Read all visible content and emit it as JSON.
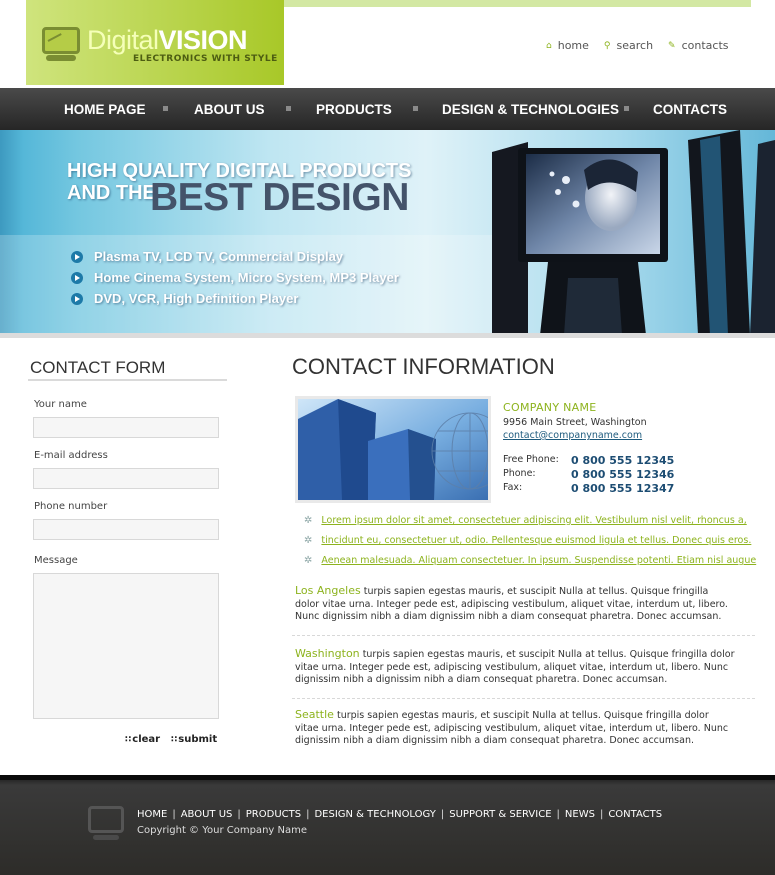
{
  "brand": {
    "name_light": "Digital",
    "name_bold": "VISION",
    "tagline": "ELECTRONICS WITH STYLE",
    "accent_color": "#8db31e"
  },
  "top_links": [
    {
      "icon": "home-icon",
      "label": "home"
    },
    {
      "icon": "search-icon",
      "label": "search"
    },
    {
      "icon": "contacts-icon",
      "label": "contacts"
    }
  ],
  "nav": [
    "HOME PAGE",
    "ABOUT US",
    "PRODUCTS",
    "DESIGN & TECHNOLOGIES",
    "CONTACTS"
  ],
  "banner": {
    "line1": "HIGH QUALITY DIGITAL PRODUCTS",
    "line2a": "AND THE",
    "line2b": "BEST DESIGN",
    "bullets": [
      "Plasma TV, LCD TV, Commercial Display",
      "Home Cinema System, Micro System, MP3 Player",
      "DVD, VCR, High Definition Player"
    ]
  },
  "contact_form": {
    "title": "CONTACT FORM",
    "fields": [
      "Your name",
      "E-mail address",
      "Phone number",
      "Message"
    ],
    "clear_label": "clear",
    "submit_label": "submit"
  },
  "contact_info": {
    "title": "CONTACT INFORMATION",
    "company_name": "COMPANY NAME",
    "address": "9956 Main Street, Washington",
    "email": "contact@companyname.com",
    "phones": [
      {
        "label": "Free Phone:",
        "value": "0 800 555 12345"
      },
      {
        "label": "Phone:",
        "value": "0 800 555 12346"
      },
      {
        "label": "Fax:",
        "value": "0 800 555 12347"
      }
    ],
    "links": [
      "Lorem ipsum dolor sit amet, consectetuer adipiscing elit. Vestibulum nisl velit, rhoncus a,",
      "tincidunt eu, consectetuer ut, odio. Pellentesque euismod ligula et tellus. Donec quis eros.",
      "Aenean malesuada. Aliquam consectetuer. In ipsum. Suspendisse potenti. Etiam nisl augue"
    ],
    "cities": [
      {
        "name": "Los Angeles",
        "text": "turpis sapien egestas mauris, et suscipit Nulla at tellus. Quisque fringilla dolor vitae urna. Integer pede est, adipiscing vestibulum, aliquet vitae, interdum ut, libero. Nunc dignissim nibh a diam dignissim nibh a diam consequat pharetra. Donec accumsan."
      },
      {
        "name": "Washington",
        "text": "turpis sapien egestas mauris, et suscipit Nulla at tellus. Quisque fringilla dolor vitae urna. Integer pede est, adipiscing vestibulum, aliquet vitae, interdum ut, libero. Nunc dignissim nibh a dignissim nibh a diam consequat pharetra. Donec accumsan."
      },
      {
        "name": "Seattle",
        "text": "turpis sapien egestas mauris, et suscipit Nulla at tellus. Quisque fringilla dolor vitae urna. Integer pede est, adipiscing vestibulum, aliquet vitae, interdum ut, libero. Nunc dignissim nibh a diam dignissim nibh a diam consequat pharetra. Donec accumsan."
      }
    ]
  },
  "footer": {
    "nav": [
      "HOME",
      "ABOUT US",
      "PRODUCTS",
      "DESIGN & TECHNOLOGY",
      "SUPPORT & SERVICE",
      "NEWS",
      "CONTACTS"
    ],
    "copyright": "Copyright © Your Company Name"
  }
}
